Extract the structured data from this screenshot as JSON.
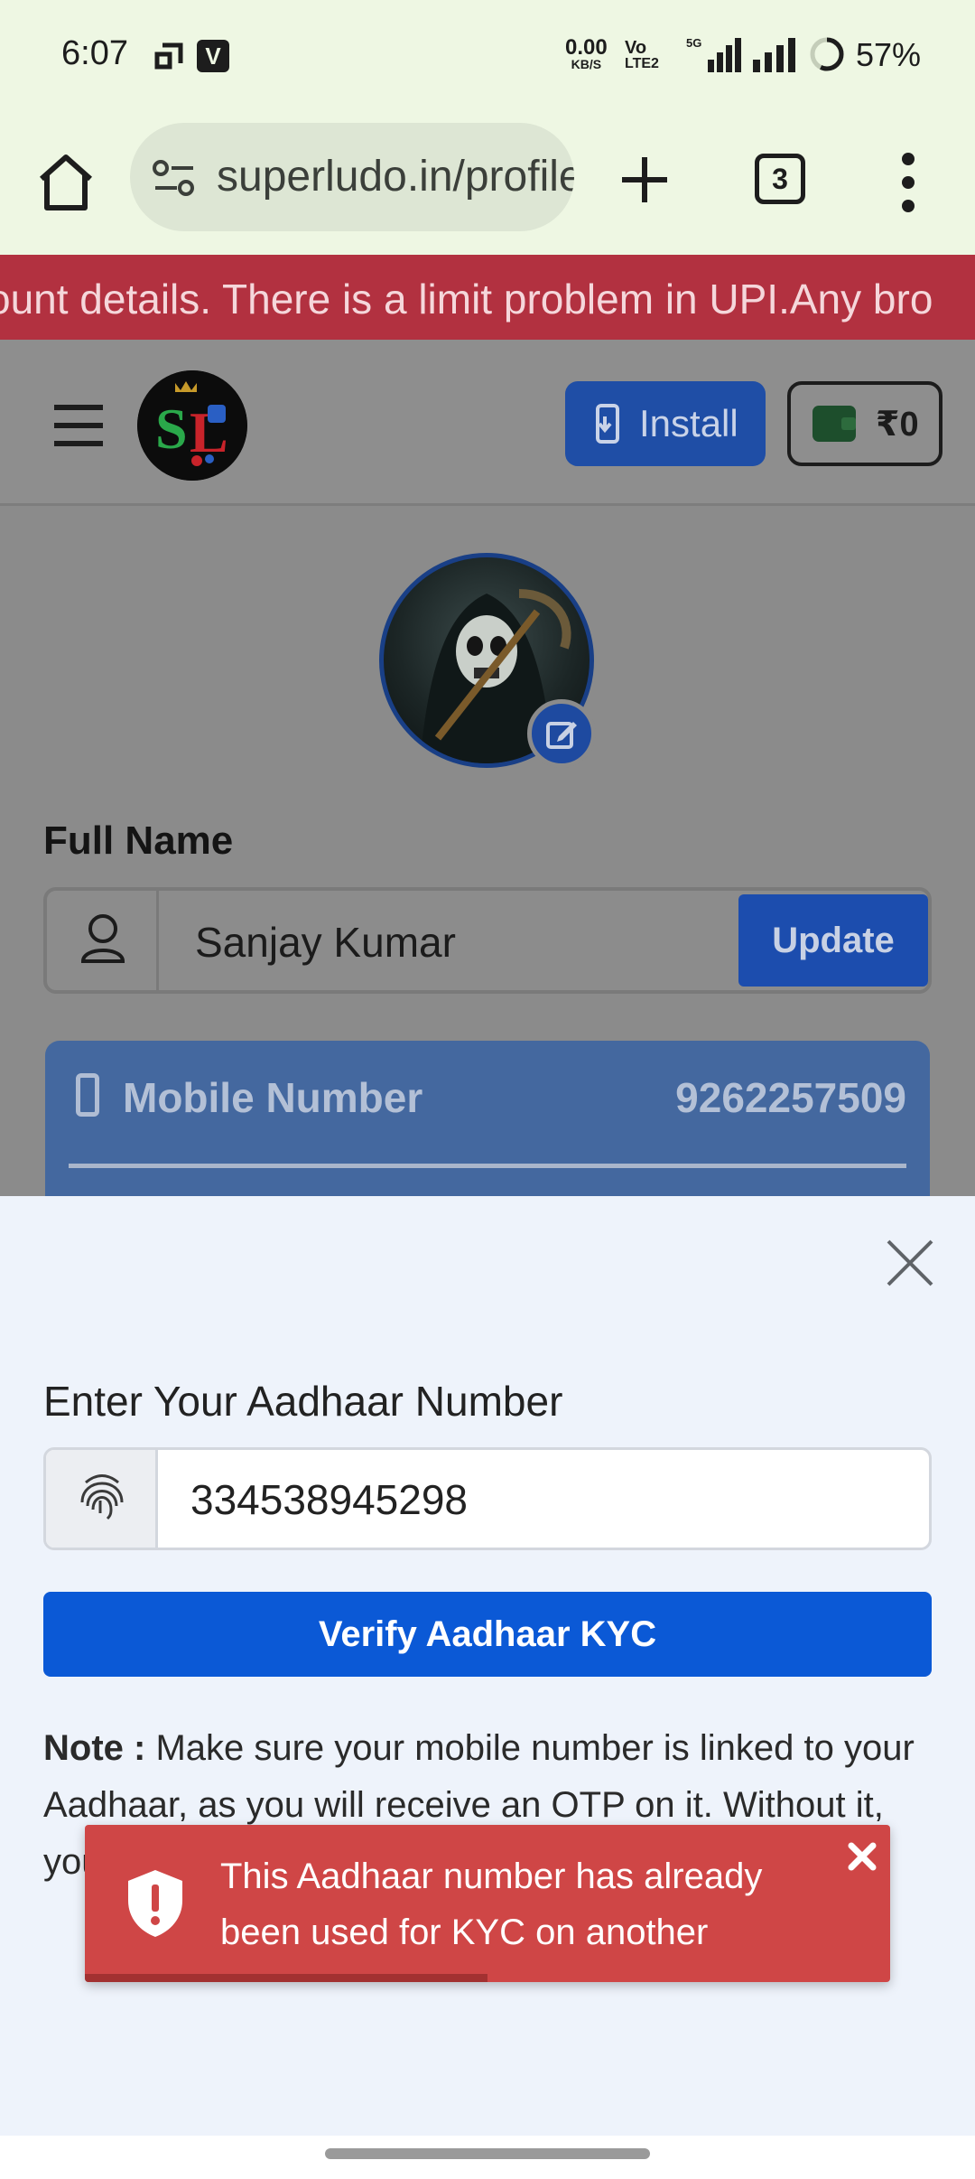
{
  "status_bar": {
    "time": "6:07",
    "net_speed_value": "0.00",
    "net_speed_unit": "KB/S",
    "volte_top": "Vo",
    "volte_bottom": "LTE2",
    "network_type": "5G",
    "battery": "57%",
    "battery_level": 0.57
  },
  "browser": {
    "url": "superludo.in/profile",
    "tab_count": "3"
  },
  "marquee": {
    "text": "ount details. There is a limit problem in UPI.Any bro"
  },
  "header": {
    "install_label": "Install",
    "wallet_balance": "₹0"
  },
  "profile": {
    "full_name_label": "Full Name",
    "full_name_value": "Sanjay Kumar",
    "update_label": "Update",
    "mobile_label": "Mobile Number",
    "mobile_value": "9262257509"
  },
  "kyc_sheet": {
    "aadhaar_label": "Enter Your Aadhaar Number",
    "aadhaar_value": "334538945298",
    "verify_label": "Verify Aadhaar KYC",
    "note_prefix": "Note :",
    "note_text": " Make sure your mobile number is linked to your Aadhaar, as you will receive an OTP on it. Without it, you cannot complete your KYC."
  },
  "toast": {
    "message": "This Aadhaar number has already been used for KYC on another account",
    "progress_remaining": 0.5,
    "color": "#cf4646"
  },
  "icons": [
    "home-icon",
    "site-settings-icon",
    "plus-icon",
    "tabs-icon",
    "more-vert-icon",
    "hamburger-icon",
    "install-icon",
    "wallet-icon",
    "edit-icon",
    "user-icon",
    "mobile-icon",
    "close-icon",
    "fingerprint-icon",
    "error-shield-icon"
  ]
}
